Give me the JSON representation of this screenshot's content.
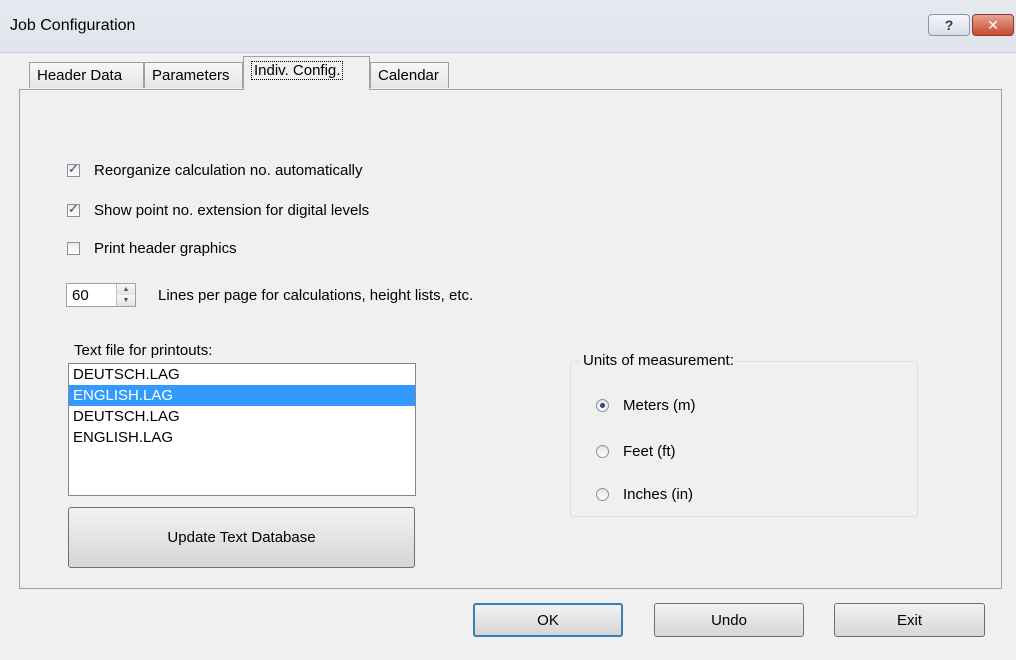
{
  "window": {
    "title": "Job Configuration",
    "help_label": "?",
    "close_label": "✕"
  },
  "tabs": [
    {
      "label": "Header Data"
    },
    {
      "label": "Parameters"
    },
    {
      "label": "Indiv. Config."
    },
    {
      "label": "Calendar"
    }
  ],
  "options": {
    "reorganize": {
      "label": "Reorganize calculation no. automatically",
      "checked": true
    },
    "point_ext": {
      "label": "Show point no. extension for digital levels",
      "checked": true
    },
    "print_header": {
      "label": "Print header graphics",
      "checked": false
    }
  },
  "lines_per_page": {
    "value": "60",
    "label": "Lines per page for calculations, height lists, etc."
  },
  "text_file": {
    "label": "Text file for printouts:",
    "items": [
      "DEUTSCH.LAG",
      "ENGLISH.LAG",
      "DEUTSCH.LAG",
      "ENGLISH.LAG"
    ],
    "selected_index": 1
  },
  "update_button": "Update Text Database",
  "units": {
    "title": "Units of measurement:",
    "options": [
      "Meters (m)",
      "Feet (ft)",
      "Inches (in)"
    ],
    "selected_index": 0
  },
  "footer": {
    "ok": "OK",
    "undo": "Undo",
    "exit": "Exit"
  },
  "colors": {
    "selection": "#3399ff",
    "window_bg": "#f0f0f0"
  }
}
